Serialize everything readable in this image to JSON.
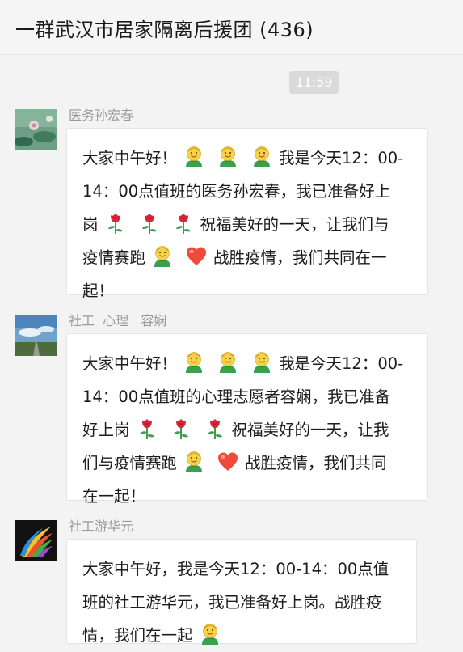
{
  "window": {
    "title": "一群武汉市居家隔离后援团 (436)"
  },
  "timestamp": "11:59",
  "colors": {
    "bubble_bg": "#ffffff",
    "page_bg": "#f3f3f3",
    "timestamp_bg": "#dadada",
    "sender_text": "#9a9a9a"
  },
  "messages": [
    {
      "sender": "医务孙宏春",
      "avatar": "lotus-pond-avatar",
      "lines": [
        {
          "parts": [
            {
              "t": "text",
              "v": "大家中午好！"
            },
            {
              "t": "icon",
              "v": "smiley-icon"
            },
            {
              "t": "icon",
              "v": "smiley-icon"
            },
            {
              "t": "icon",
              "v": "smiley-icon"
            },
            {
              "t": "text",
              "v": "我是今天12：00-"
            }
          ]
        },
        {
          "parts": [
            {
              "t": "text",
              "v": "14：00点值班的医务孙宏春，我已准备好上"
            }
          ]
        },
        {
          "parts": [
            {
              "t": "text",
              "v": "岗"
            },
            {
              "t": "icon",
              "v": "rose-icon"
            },
            {
              "t": "icon",
              "v": "rose-icon"
            },
            {
              "t": "icon",
              "v": "rose-icon"
            },
            {
              "t": "text",
              "v": "祝福美好的一天，让我们与"
            }
          ]
        },
        {
          "parts": [
            {
              "t": "text",
              "v": "疫情赛跑"
            },
            {
              "t": "icon",
              "v": "smiley-icon"
            },
            {
              "t": "icon",
              "v": "heart-icon"
            },
            {
              "t": "text",
              "v": "战胜疫情，我们共同在一"
            }
          ]
        },
        {
          "parts": [
            {
              "t": "text",
              "v": "起！"
            }
          ]
        }
      ]
    },
    {
      "sender": "社工  心理   容娴",
      "avatar": "sky-road-avatar",
      "lines": [
        {
          "parts": [
            {
              "t": "text",
              "v": "大家中午好！"
            },
            {
              "t": "icon",
              "v": "smiley-icon"
            },
            {
              "t": "icon",
              "v": "smiley-icon"
            },
            {
              "t": "icon",
              "v": "smiley-icon"
            },
            {
              "t": "text",
              "v": "我是今天12：00-"
            }
          ]
        },
        {
          "parts": [
            {
              "t": "text",
              "v": "14：00点值班的心理志愿者容娴，我已准备"
            }
          ]
        },
        {
          "parts": [
            {
              "t": "text",
              "v": "好上岗"
            },
            {
              "t": "icon",
              "v": "rose-icon"
            },
            {
              "t": "icon",
              "v": "rose-icon"
            },
            {
              "t": "icon",
              "v": "rose-icon"
            },
            {
              "t": "text",
              "v": "祝福美好的一天，让我"
            }
          ]
        },
        {
          "parts": [
            {
              "t": "text",
              "v": "们与疫情赛跑"
            },
            {
              "t": "icon",
              "v": "smiley-icon"
            },
            {
              "t": "icon",
              "v": "heart-icon"
            },
            {
              "t": "text",
              "v": "战胜疫情，我们共同"
            }
          ]
        },
        {
          "parts": [
            {
              "t": "text",
              "v": "在一起！"
            }
          ]
        }
      ]
    },
    {
      "sender": "社工游华元",
      "avatar": "colorful-logo-avatar",
      "lines": [
        {
          "parts": [
            {
              "t": "text",
              "v": "大家中午好，我是今天12：00-14：00点值"
            }
          ]
        },
        {
          "parts": [
            {
              "t": "text",
              "v": "班的社工游华元，我已准备好上岗。战胜疫"
            }
          ]
        },
        {
          "parts": [
            {
              "t": "text",
              "v": "情，我们在一起"
            },
            {
              "t": "icon",
              "v": "smiley-icon"
            }
          ]
        }
      ]
    }
  ]
}
